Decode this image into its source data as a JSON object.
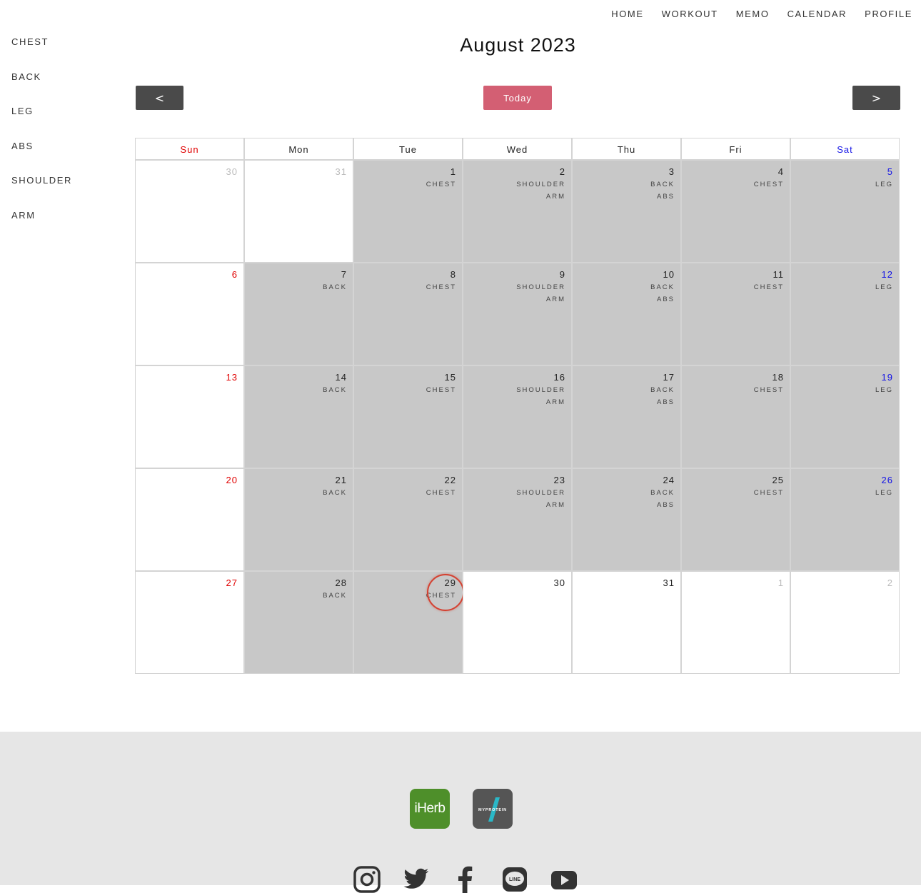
{
  "nav": [
    "HOME",
    "WORKOUT",
    "MEMO",
    "CALENDAR",
    "PROFILE"
  ],
  "sidebar": [
    "CHEST",
    "BACK",
    "LEG",
    "ABS",
    "SHOULDER",
    "ARM"
  ],
  "calendar": {
    "title": "August 2023",
    "prev_label": "<",
    "next_label": ">",
    "today_label": "Today",
    "weekdays": [
      "Sun",
      "Mon",
      "Tue",
      "Wed",
      "Thu",
      "Fri",
      "Sat"
    ],
    "weeks": [
      [
        {
          "day": "30",
          "other": true,
          "tags": []
        },
        {
          "day": "31",
          "other": true,
          "tags": []
        },
        {
          "day": "1",
          "tags": [
            "CHEST"
          ]
        },
        {
          "day": "2",
          "tags": [
            "SHOULDER",
            "ARM"
          ]
        },
        {
          "day": "3",
          "tags": [
            "BACK",
            "ABS"
          ]
        },
        {
          "day": "4",
          "tags": [
            "CHEST"
          ]
        },
        {
          "day": "5",
          "tags": [
            "LEG"
          ]
        }
      ],
      [
        {
          "day": "6",
          "tags": []
        },
        {
          "day": "7",
          "tags": [
            "BACK"
          ]
        },
        {
          "day": "8",
          "tags": [
            "CHEST"
          ]
        },
        {
          "day": "9",
          "tags": [
            "SHOULDER",
            "ARM"
          ]
        },
        {
          "day": "10",
          "tags": [
            "BACK",
            "ABS"
          ]
        },
        {
          "day": "11",
          "tags": [
            "CHEST"
          ]
        },
        {
          "day": "12",
          "tags": [
            "LEG"
          ]
        }
      ],
      [
        {
          "day": "13",
          "tags": []
        },
        {
          "day": "14",
          "tags": [
            "BACK"
          ]
        },
        {
          "day": "15",
          "tags": [
            "CHEST"
          ]
        },
        {
          "day": "16",
          "tags": [
            "SHOULDER",
            "ARM"
          ]
        },
        {
          "day": "17",
          "tags": [
            "BACK",
            "ABS"
          ]
        },
        {
          "day": "18",
          "tags": [
            "CHEST"
          ]
        },
        {
          "day": "19",
          "tags": [
            "LEG"
          ]
        }
      ],
      [
        {
          "day": "20",
          "tags": []
        },
        {
          "day": "21",
          "tags": [
            "BACK"
          ]
        },
        {
          "day": "22",
          "tags": [
            "CHEST"
          ]
        },
        {
          "day": "23",
          "tags": [
            "SHOULDER",
            "ARM"
          ]
        },
        {
          "day": "24",
          "tags": [
            "BACK",
            "ABS"
          ]
        },
        {
          "day": "25",
          "tags": [
            "CHEST"
          ]
        },
        {
          "day": "26",
          "tags": [
            "LEG"
          ]
        }
      ],
      [
        {
          "day": "27",
          "tags": []
        },
        {
          "day": "28",
          "tags": [
            "BACK"
          ]
        },
        {
          "day": "29",
          "tags": [
            "CHEST"
          ],
          "marked": true
        },
        {
          "day": "30",
          "tags": []
        },
        {
          "day": "31",
          "tags": []
        },
        {
          "day": "1",
          "other": true,
          "tags": []
        },
        {
          "day": "2",
          "other": true,
          "tags": []
        }
      ]
    ]
  },
  "footer": {
    "stores": [
      {
        "name": "iherb-logo",
        "text": "iHerb"
      },
      {
        "name": "myprotein-logo",
        "text": "MYPROTEIN"
      }
    ],
    "socials": [
      "instagram-icon",
      "twitter-icon",
      "facebook-icon",
      "line-icon",
      "youtube-icon"
    ]
  },
  "colors": {
    "workout_cell": "#c8c8c8",
    "today_button": "#d35f73",
    "nav_button": "#4a4a4a",
    "sunday": "#e00000",
    "saturday": "#1414e6",
    "marker": "#d44030"
  }
}
